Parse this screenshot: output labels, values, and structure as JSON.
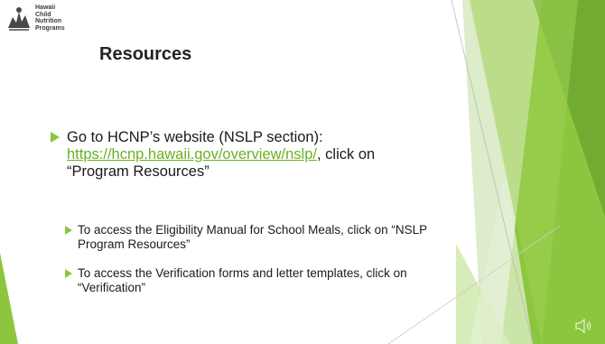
{
  "slide": {
    "logo_lines": [
      "Hawaii",
      "Child",
      "Nutrition",
      "Programs"
    ],
    "title": "Resources",
    "bullet1": {
      "pre": "Go to HCNP’s website (NSLP section): ",
      "link": "https://hcnp.hawaii.gov/overview/nslp/",
      "post": ", click on “Program Resources”"
    },
    "bullet2": "To access the Eligibility Manual for School Meals, click on “NSLP Program Resources”",
    "bullet3": "To access the Verification forms and letter templates, click on “Verification”"
  },
  "colors": {
    "accent": "#8cc63e",
    "link": "#6ab023"
  },
  "icons": [
    "logo-mark",
    "speaker-icon"
  ]
}
